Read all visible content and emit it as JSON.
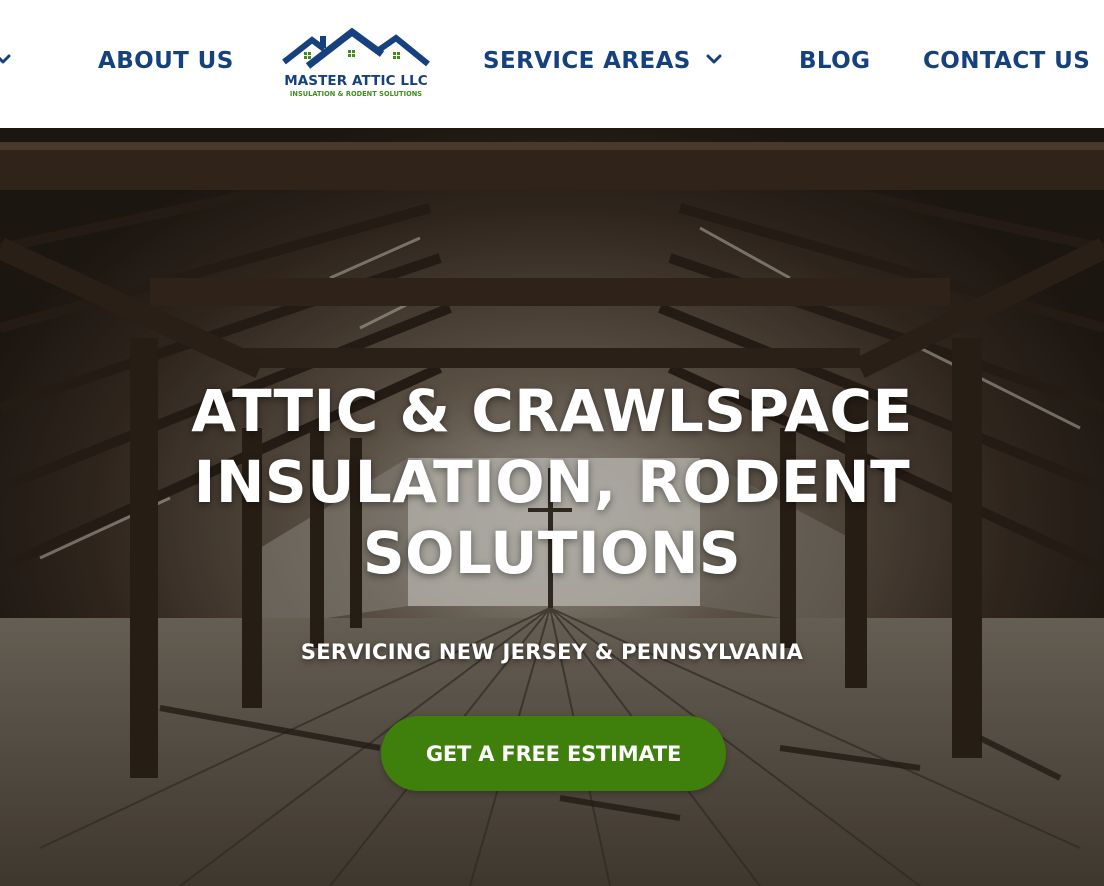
{
  "nav": {
    "items": [
      {
        "label": "ABOUT US"
      },
      {
        "label": "SERVICE AREAS"
      },
      {
        "label": "BLOG"
      },
      {
        "label": "CONTACT US"
      }
    ]
  },
  "logo": {
    "title": "MASTER ATTIC LLC",
    "subtitle": "INSULATION & RODENT SOLUTIONS"
  },
  "hero": {
    "title_lines": [
      "ATTIC & CRAWLSPACE",
      "INSULATION, RODENT",
      "SOLUTIONS"
    ],
    "subtitle": "SERVICING NEW JERSEY & PENNSYLVANIA",
    "cta_label": "GET A FREE ESTIMATE"
  },
  "colors": {
    "brand_blue": "#16417f",
    "brand_green": "#3f7f0c",
    "cta_bg": "#3f7f0c",
    "header_bg": "#ffffff"
  },
  "icons": {
    "dropdown": "chevron-down-icon"
  }
}
